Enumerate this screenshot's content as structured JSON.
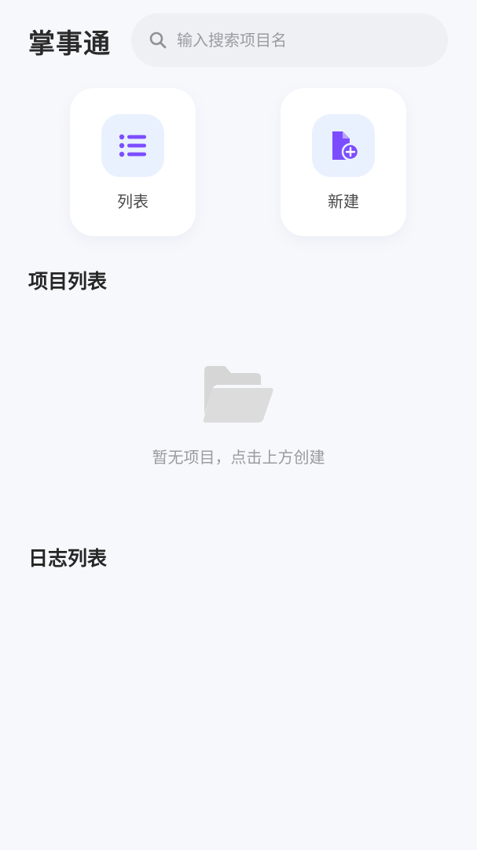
{
  "app": {
    "title": "掌事通"
  },
  "search": {
    "placeholder": "输入搜索项目名",
    "value": ""
  },
  "quick_actions": [
    {
      "label": "列表",
      "icon": "list-icon",
      "accent": "#7c4dff"
    },
    {
      "label": "新建",
      "icon": "new-file-icon",
      "accent": "#7c4dff"
    }
  ],
  "sections": {
    "projects": {
      "title": "项目列表",
      "empty_text": "暂无项目，点击上方创建",
      "empty_icon": "folder-open-icon"
    },
    "logs": {
      "title": "日志列表"
    }
  },
  "colors": {
    "background": "#f7f8fc",
    "accent": "#7c4dff",
    "icon_tile": "#eaf1fe",
    "empty_icon": "#d9d9d9"
  }
}
